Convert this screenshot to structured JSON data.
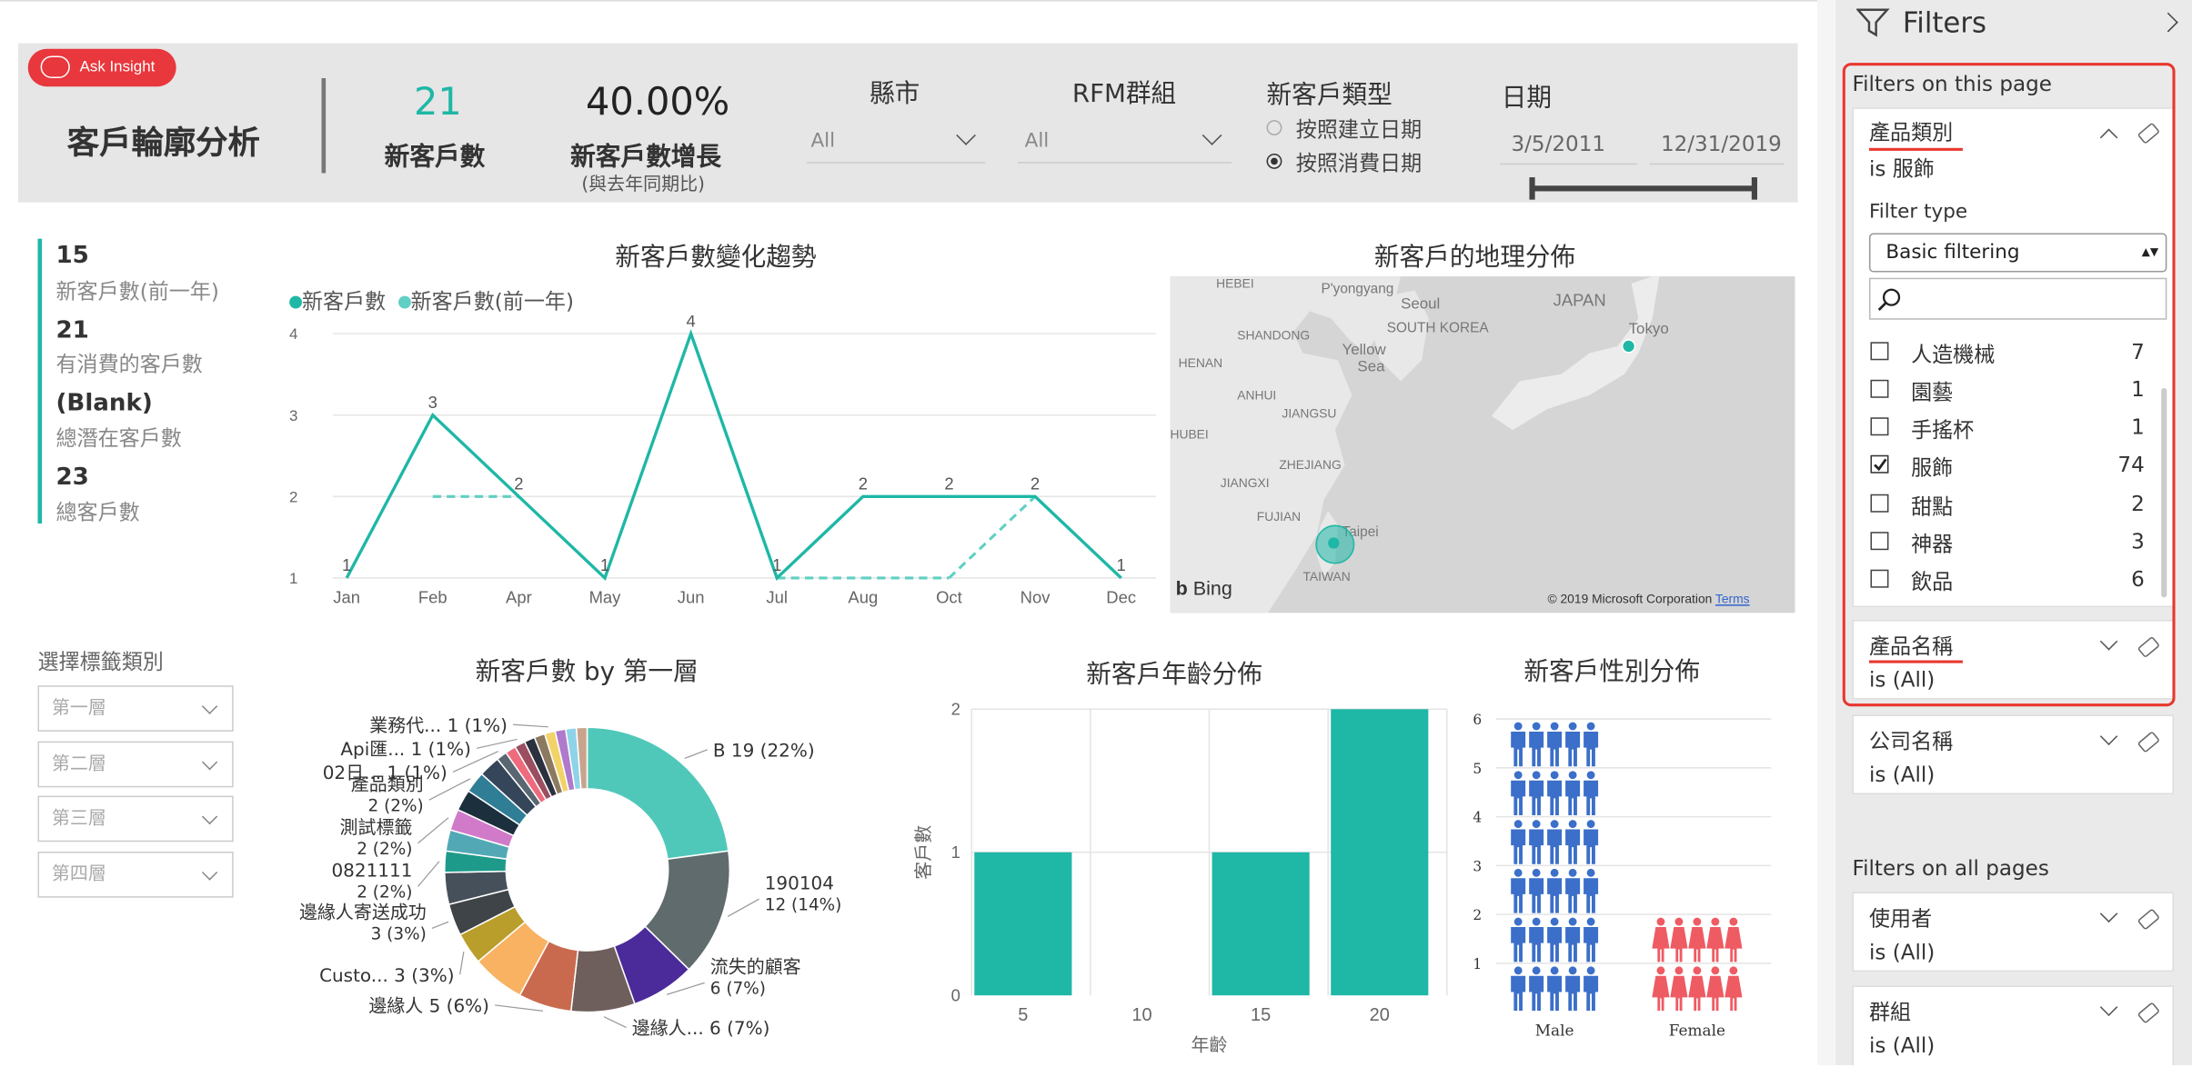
{
  "header": {
    "ask_insight": "Ask Insight",
    "title": "客戶輪廓分析",
    "kpi_new_customers": {
      "value": "21",
      "label": "新客戶數"
    },
    "kpi_growth": {
      "value": "40.00%",
      "label": "新客戶數增長",
      "sublabel": "(與去年同期比)"
    },
    "slicer_city": {
      "title": "縣市",
      "value": "All"
    },
    "slicer_rfm": {
      "title": "RFM群組",
      "value": "All"
    },
    "customer_type": {
      "title": "新客戶類型",
      "options": [
        "按照建立日期",
        "按照消費日期"
      ],
      "selected": "按照消費日期"
    },
    "date": {
      "title": "日期",
      "start": "3/5/2011",
      "end": "12/31/2019"
    }
  },
  "stats": [
    {
      "value": "15",
      "label": "新客戶數(前一年)"
    },
    {
      "value": "21",
      "label": "有消費的客戶數"
    },
    {
      "value": "(Blank)",
      "label": "總潛在客戶數"
    },
    {
      "value": "23",
      "label": "總客戶數"
    }
  ],
  "tag_selector": {
    "title": "選擇標籤類別",
    "levels": [
      "第一層",
      "第二層",
      "第三層",
      "第四層"
    ]
  },
  "map": {
    "title": "新客戶的地理分佈",
    "labels": [
      "HEBEI",
      "P'yongyang",
      "Seoul",
      "JAPAN",
      "SHANDONG",
      "SOUTH KOREA",
      "Tokyo",
      "HENAN",
      "Yellow",
      "Sea",
      "JIANGSU",
      "ANHUI",
      "HUBEI",
      "ZHEJIANG",
      "JIANGXI",
      "FUJIAN",
      "Taipei",
      "TAIWAN"
    ],
    "brand": "Bing",
    "copyright": "© 2019 Microsoft Corporation",
    "terms": "Terms"
  },
  "colors": {
    "teal": "#1fb7a6",
    "teal_light": "#5fd0c3",
    "accent_red": "#e8373d",
    "male": "#3b6fc9",
    "female": "#ee5b63",
    "highlight": "#e8372e"
  },
  "filters": {
    "title": "Filters",
    "on_this_page": "Filters on this page",
    "on_all_pages": "Filters on all pages",
    "category": {
      "name": "產品類別",
      "state": "is 服飾",
      "filter_type_label": "Filter type",
      "filter_type": "Basic filtering",
      "items": [
        {
          "label": "人造機械",
          "count": "7",
          "checked": false
        },
        {
          "label": "園藝",
          "count": "1",
          "checked": false
        },
        {
          "label": "手搖杯",
          "count": "1",
          "checked": false
        },
        {
          "label": "服飾",
          "count": "74",
          "checked": true
        },
        {
          "label": "甜點",
          "count": "2",
          "checked": false
        },
        {
          "label": "神器",
          "count": "3",
          "checked": false
        },
        {
          "label": "飲品",
          "count": "6",
          "checked": false
        }
      ]
    },
    "product_name": {
      "name": "產品名稱",
      "state": "is (All)"
    },
    "company_name": {
      "name": "公司名稱",
      "state": "is (All)"
    },
    "user": {
      "name": "使用者",
      "state": "is (All)"
    },
    "group": {
      "name": "群組",
      "state": "is (All)"
    }
  },
  "chart_data": [
    {
      "type": "line",
      "title": "新客戶數變化趨勢",
      "categories": [
        "Jan",
        "Feb",
        "Apr",
        "May",
        "Jun",
        "Jul",
        "Aug",
        "Oct",
        "Nov",
        "Dec"
      ],
      "ylim": [
        1,
        4
      ],
      "yticks": [
        "1",
        "2",
        "3",
        "4"
      ],
      "series": [
        {
          "name": "新客戶數",
          "values": [
            1,
            3,
            2,
            1,
            4,
            1,
            2,
            2,
            2,
            1
          ]
        },
        {
          "name": "新客戶數(前一年)",
          "values": [
            null,
            2,
            2,
            null,
            4,
            1,
            1,
            1,
            2,
            1
          ]
        }
      ],
      "data_labels": [
        "1",
        "3",
        "2",
        "1",
        "4",
        "1",
        "2",
        "2",
        "2",
        "1"
      ]
    },
    {
      "type": "pie",
      "title": "新客戶數 by 第一層",
      "slices": [
        {
          "label": "B 19 (22%)",
          "value": 19,
          "color": "#4fc8b9"
        },
        {
          "label": "190104 12 (14%)",
          "value": 12,
          "color": "#5f6b6d"
        },
        {
          "label": "流失的顧客 6 (7%)",
          "value": 6,
          "color": "#4b2b9a"
        },
        {
          "label": "邊緣人... 6 (7%)",
          "value": 6,
          "color": "#6f5f5c"
        },
        {
          "label": "邊緣人 5 (6%)",
          "value": 5,
          "color": "#c96a4f"
        },
        {
          "label": "",
          "value": 5,
          "color": "#f8b262"
        },
        {
          "label": "Custo... 3 (3%)",
          "value": 3,
          "color": "#b99e2c"
        },
        {
          "label": "邊緣人寄送成功 3 (3%)",
          "value": 3,
          "color": "#3f4448"
        },
        {
          "label": "",
          "value": 3,
          "color": "#46505a"
        },
        {
          "label": "0821111 2 (2%)",
          "value": 2,
          "color": "#1e9a8a"
        },
        {
          "label": "",
          "value": 2,
          "color": "#52a9b5"
        },
        {
          "label": "測試標籤 2 (2%)",
          "value": 2,
          "color": "#d07ac9"
        },
        {
          "label": "",
          "value": 2,
          "color": "#1b2f3d"
        },
        {
          "label": "產品類別 2 (2%)",
          "value": 2,
          "color": "#2f7e96"
        },
        {
          "label": "",
          "value": 2,
          "color": "#35465a"
        },
        {
          "label": "02日... 1 (1%)",
          "value": 1,
          "color": "#5a6672"
        },
        {
          "label": "",
          "value": 1,
          "color": "#ee6b7d"
        },
        {
          "label": "Api匯... 1 (1%)",
          "value": 1,
          "color": "#9c4e61"
        },
        {
          "label": "",
          "value": 1,
          "color": "#2c3140"
        },
        {
          "label": "",
          "value": 1,
          "color": "#8c7a60"
        },
        {
          "label": "業務代... 1 (1%)",
          "value": 1,
          "color": "#f2d36a"
        },
        {
          "label": "",
          "value": 1,
          "color": "#b07acc"
        },
        {
          "label": "",
          "value": 1,
          "color": "#8fd3e8"
        },
        {
          "label": "",
          "value": 1,
          "color": "#c9a48d"
        }
      ]
    },
    {
      "type": "bar",
      "title": "新客戶年齡分佈",
      "xlabel": "年齡",
      "ylabel": "客戶數",
      "x": [
        5,
        10,
        15,
        20
      ],
      "values": [
        1,
        0,
        1,
        2
      ],
      "ylim": [
        0,
        2
      ],
      "yticks": [
        "0",
        "1",
        "2"
      ]
    },
    {
      "type": "bar",
      "title": "新客戶性別分佈",
      "categories": [
        "Male",
        "Female"
      ],
      "values": [
        6,
        2
      ],
      "ylim": [
        0,
        6
      ],
      "yticks": [
        "1",
        "2",
        "3",
        "4",
        "5",
        "6"
      ]
    }
  ]
}
